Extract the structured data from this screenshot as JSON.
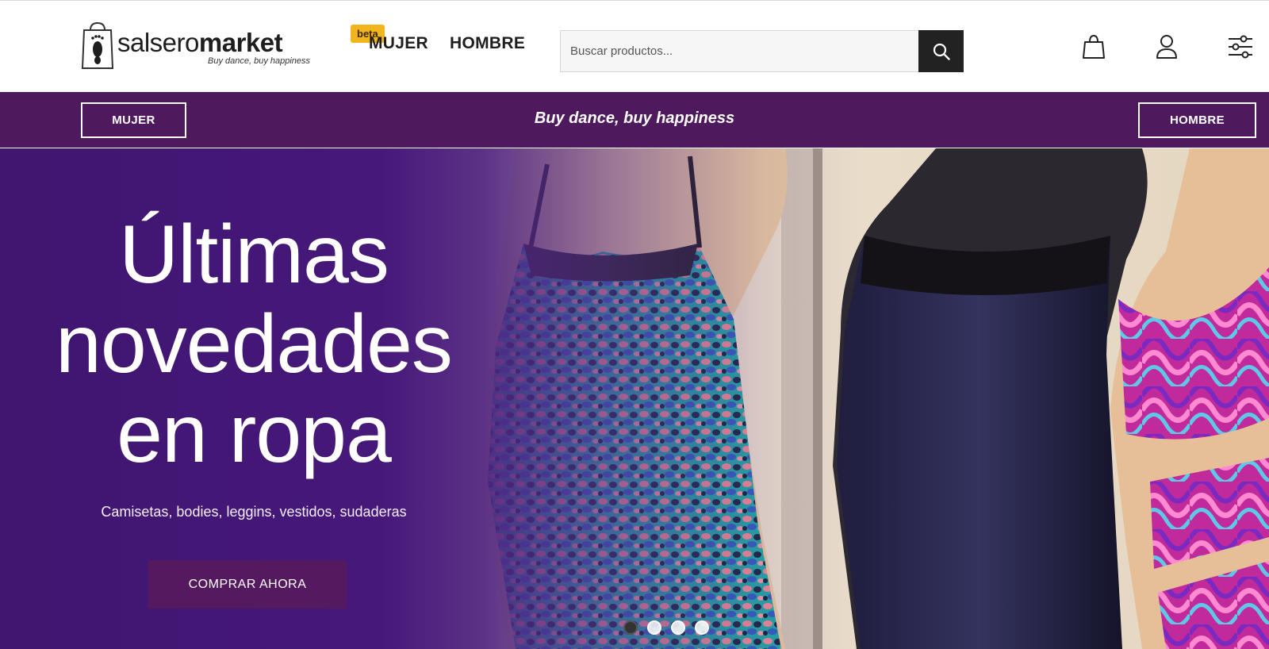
{
  "header": {
    "logo": {
      "word1": "salsero",
      "word2": "market",
      "tagline": "Buy dance, buy happiness",
      "badge": "beta"
    },
    "nav": [
      {
        "label": "MUJER"
      },
      {
        "label": "HOMBRE"
      }
    ],
    "search": {
      "placeholder": "Buscar productos...",
      "value": "",
      "button_icon": "search-icon"
    },
    "icons": [
      "shopping-bag-icon",
      "user-icon",
      "filter-sliders-icon"
    ]
  },
  "band": {
    "left_button": "MUJER",
    "slogan": "Buy dance, buy happiness",
    "right_button": "HOMBRE"
  },
  "hero": {
    "title_lines": [
      "Últimas",
      "novedades",
      "en ropa"
    ],
    "subtitle": "Camisetas, bodies, leggins, vestidos, sudaderas",
    "cta": "COMPRAR AHORA",
    "carousel": {
      "slides": 4,
      "active_index": 0
    }
  },
  "colors": {
    "brand_purple": "#4f1a5d",
    "hero_purple": "#46187a",
    "cta_purple": "#54195e",
    "beta_badge": "#f2b51e",
    "search_button": "#222222"
  }
}
